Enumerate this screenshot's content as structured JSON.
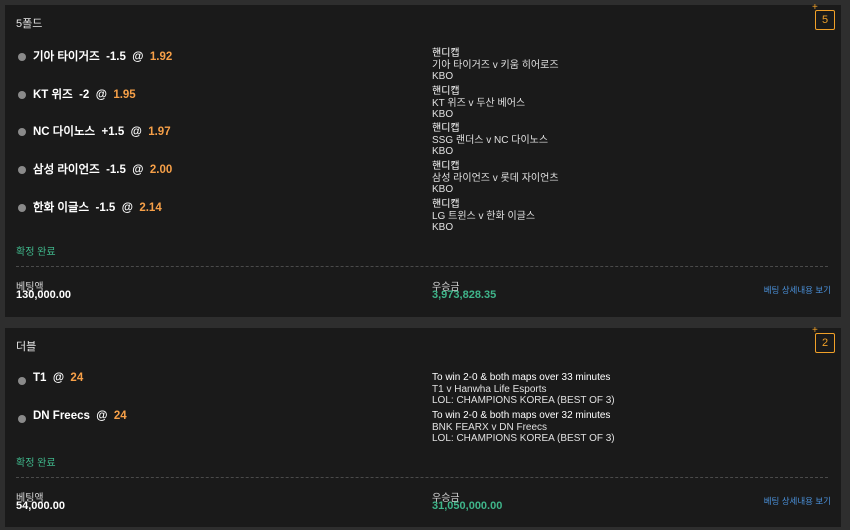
{
  "cards": [
    {
      "title": "5폴드",
      "count": "5",
      "count_plus": "+",
      "selections": [
        {
          "team": "기아 타이거즈",
          "line": "-1.5",
          "at": "@",
          "odds": "1.92",
          "market_type": "핸디캡",
          "match": "기아 타이거즈 v 키움 히어로즈",
          "league": "KBO"
        },
        {
          "team": "KT 위즈",
          "line": "-2",
          "at": "@",
          "odds": "1.95",
          "market_type": "핸디캡",
          "match": "KT 위즈 v 두산 베어스",
          "league": "KBO"
        },
        {
          "team": "NC 다이노스",
          "line": "+1.5",
          "at": "@",
          "odds": "1.97",
          "market_type": "핸디캡",
          "match": "SSG 랜더스 v NC 다이노스",
          "league": "KBO"
        },
        {
          "team": "삼성 라이언즈",
          "line": "-1.5",
          "at": "@",
          "odds": "2.00",
          "market_type": "핸디캡",
          "match": "삼성 라이언즈 v 롯데 자이언츠",
          "league": "KBO"
        },
        {
          "team": "한화 이글스",
          "line": "-1.5",
          "at": "@",
          "odds": "2.14",
          "market_type": "핸디캡",
          "match": "LG 트윈스 v 한화 이글스",
          "league": "KBO"
        }
      ],
      "status": "확정 완료",
      "stake_label": "베팅액",
      "stake_value": "130,000.00",
      "win_label": "우승금",
      "win_value": "3,973,828.35",
      "detail_link": "베팅 상세내용 보기"
    },
    {
      "title": "더블",
      "count": "2",
      "count_plus": "+",
      "selections": [
        {
          "team": "T1",
          "line": "",
          "at": "@",
          "odds": "24",
          "market_type": "To win 2-0 & both maps over 33 minutes",
          "match": "T1 v Hanwha Life Esports",
          "league": "LOL: CHAMPIONS KOREA (BEST OF 3)"
        },
        {
          "team": "DN Freecs",
          "line": "",
          "at": "@",
          "odds": "24",
          "market_type": "To win 2-0 & both maps over 32 minutes",
          "match": "BNK FEARX v DN Freecs",
          "league": "LOL: CHAMPIONS KOREA (BEST OF 3)"
        }
      ],
      "status": "확정 완료",
      "stake_label": "베팅액",
      "stake_value": "54,000.00",
      "win_label": "우승금",
      "win_value": "31,050,000.00",
      "detail_link": "베팅 상세내용 보기"
    }
  ]
}
